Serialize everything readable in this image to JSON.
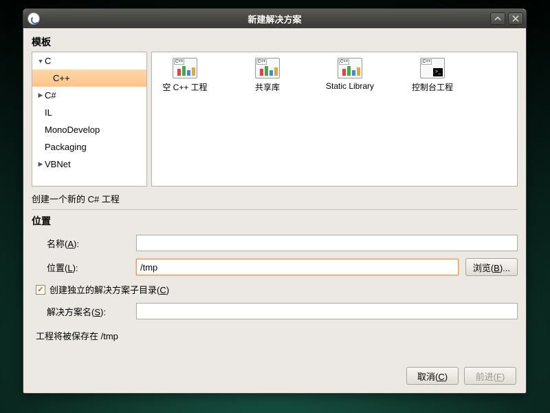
{
  "window": {
    "title": "新建解决方案"
  },
  "templatesSection": "模板",
  "tree": {
    "c": "C",
    "cpp": "C++",
    "csharp": "C#",
    "il": "IL",
    "monodevelop": "MonoDevelop",
    "packaging": "Packaging",
    "vbnet": "VBNet"
  },
  "templates": {
    "emptyCpp": "空 C++ 工程",
    "sharedLib": "共享库",
    "staticLib": "Static Library",
    "console": "控制台工程"
  },
  "description": "创建一个新的 C# 工程",
  "locationSection": "位置",
  "form": {
    "nameLabel": "名称(",
    "nameAccel": "A",
    "nameLabelEnd": "):",
    "nameValue": "",
    "locationLabel": "位置(",
    "locationAccel": "L",
    "locationLabelEnd": "):",
    "locationValue": "/tmp",
    "browseLabel": "浏览(",
    "browseAccel": "B",
    "browseLabelEnd": ")...",
    "createSubdirLabel": "创建独立的解决方案子目录(",
    "createSubdirAccel": "C",
    "createSubdirLabelEnd": ")",
    "solutionNameLabel": "解决方案名(",
    "solutionNameAccel": "S",
    "solutionNameLabelEnd": "):",
    "solutionNameValue": "",
    "saveNote": "工程将被保存在 /tmp"
  },
  "buttons": {
    "cancelLabel": "取消(",
    "cancelAccel": "C",
    "cancelLabelEnd": ")",
    "forwardLabel": "前进(",
    "forwardAccel": "F",
    "forwardLabelEnd": ")"
  }
}
